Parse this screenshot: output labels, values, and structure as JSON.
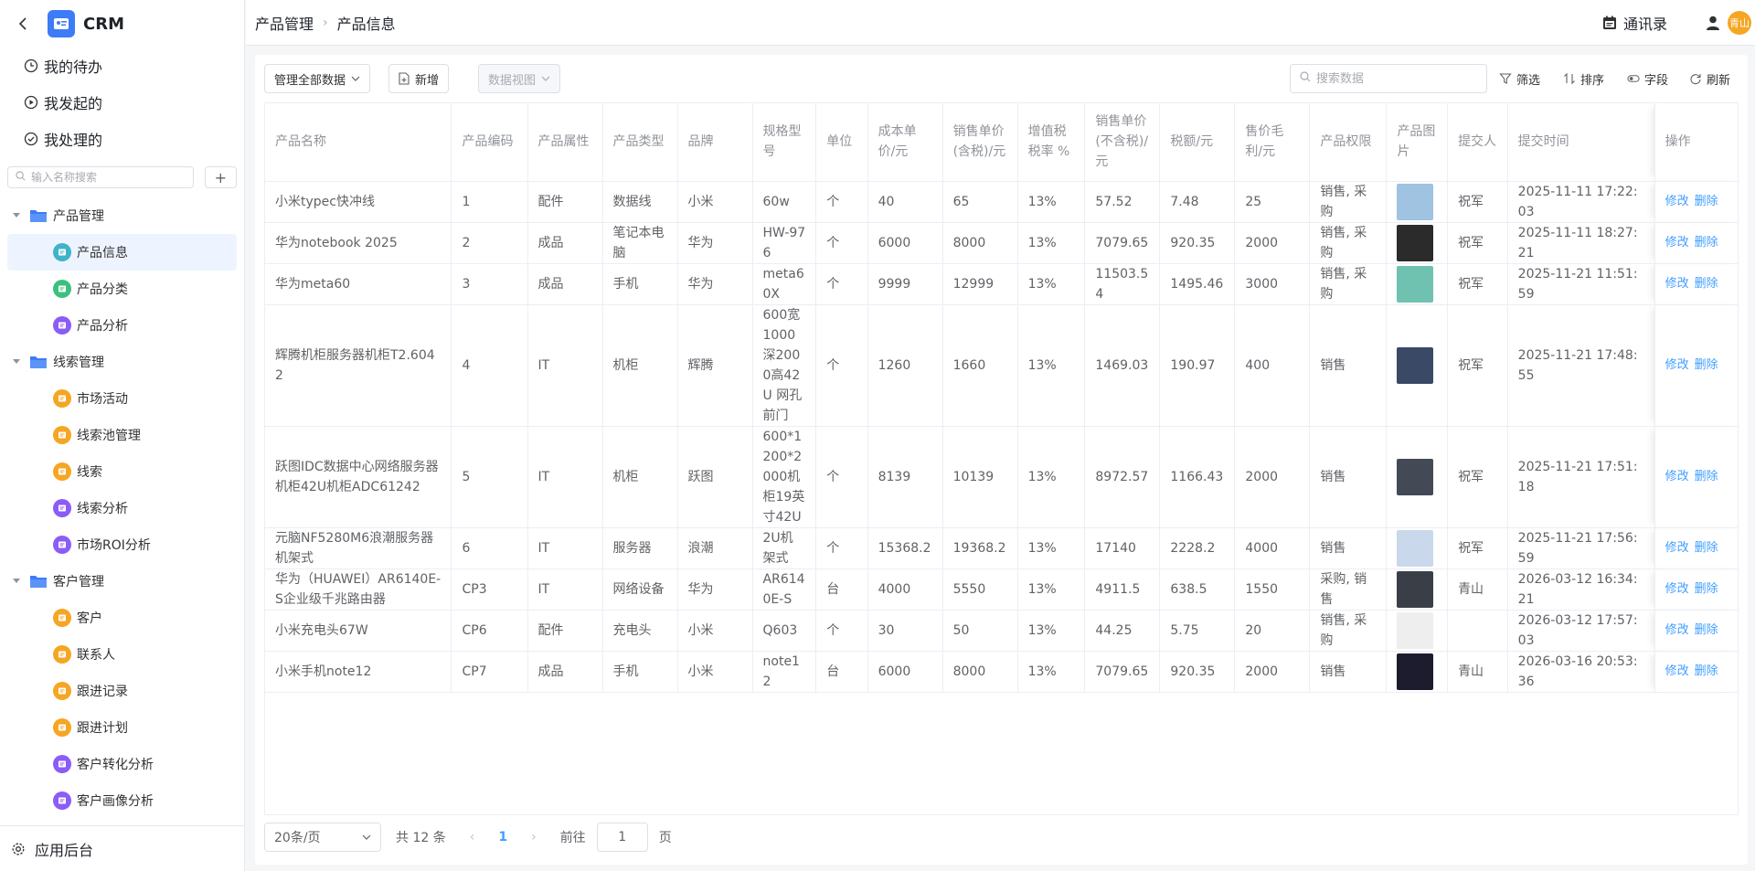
{
  "app": {
    "name": "CRM",
    "back_icon": "chevron-left-icon",
    "logo_icon": "crm-logo-icon",
    "accent": "#3d7bf7"
  },
  "quick": [
    {
      "label": "我的待办",
      "icon": "clock-icon"
    },
    {
      "label": "我发起的",
      "icon": "play-circle-icon"
    },
    {
      "label": "我处理的",
      "icon": "check-circle-icon"
    }
  ],
  "tree_search": {
    "placeholder": "输入名称搜索",
    "add": "+"
  },
  "tree": [
    {
      "label": "产品管理",
      "children": [
        {
          "label": "产品信息",
          "color": "#3fb4c8",
          "active": true
        },
        {
          "label": "产品分类",
          "color": "#3cc07e"
        },
        {
          "label": "产品分析",
          "color": "#8b5cf6"
        }
      ]
    },
    {
      "label": "线索管理",
      "children": [
        {
          "label": "市场活动",
          "color": "#f5a623"
        },
        {
          "label": "线索池管理",
          "color": "#f5a623"
        },
        {
          "label": "线索",
          "color": "#f5a623"
        },
        {
          "label": "线索分析",
          "color": "#8b5cf6"
        },
        {
          "label": "市场ROI分析",
          "color": "#8b5cf6"
        }
      ]
    },
    {
      "label": "客户管理",
      "children": [
        {
          "label": "客户",
          "color": "#f5a623"
        },
        {
          "label": "联系人",
          "color": "#f5a623"
        },
        {
          "label": "跟进记录",
          "color": "#f5a623"
        },
        {
          "label": "跟进计划",
          "color": "#f5a623"
        },
        {
          "label": "客户转化分析",
          "color": "#8b5cf6"
        },
        {
          "label": "客户画像分析",
          "color": "#8b5cf6"
        }
      ]
    }
  ],
  "side_bottom": {
    "label": "应用后台",
    "icon": "gear-icon"
  },
  "header": {
    "crumbs": [
      "产品管理",
      "产品信息"
    ],
    "contacts": "通讯录",
    "avatar": "青山"
  },
  "toolbar": {
    "scope": "管理全部数据",
    "add": "新增",
    "view": "数据视图",
    "search_placeholder": "搜索数据",
    "filter": "筛选",
    "sort": "排序",
    "fields": "字段",
    "refresh": "刷新"
  },
  "columns": [
    "产品名称",
    "产品编码",
    "产品属性",
    "产品类型",
    "品牌",
    "规格型号",
    "单位",
    "成本单价/元",
    "销售单价(含税)/元",
    "增值税税率 %",
    "销售单价(不含税)/元",
    "税额/元",
    "售价毛利/元",
    "产品权限",
    "产品图片",
    "提交人",
    "提交时间",
    "操作"
  ],
  "rows": [
    {
      "name": "小米typec快冲线",
      "code": "1",
      "attr": "配件",
      "type": "数据线",
      "brand": "小米",
      "spec": "60w",
      "unit": "个",
      "cost": "40",
      "price_tax": "65",
      "rate": "13%",
      "price_notax": "57.52",
      "tax": "7.48",
      "margin": "25",
      "perm": "销售, 采购",
      "img_color": "#9fc3e0",
      "submitter": "祝军",
      "time": "2025-11-11 17:22:03"
    },
    {
      "name": "华为notebook 2025",
      "code": "2",
      "attr": "成品",
      "type": "笔记本电脑",
      "brand": "华为",
      "spec": "HW-976",
      "unit": "个",
      "cost": "6000",
      "price_tax": "8000",
      "rate": "13%",
      "price_notax": "7079.65",
      "tax": "920.35",
      "margin": "2000",
      "perm": "销售, 采购",
      "img_color": "#2b2b2b",
      "submitter": "祝军",
      "time": "2025-11-11 18:27:21"
    },
    {
      "name": "华为meta60",
      "code": "3",
      "attr": "成品",
      "type": "手机",
      "brand": "华为",
      "spec": "meta60X",
      "unit": "个",
      "cost": "9999",
      "price_tax": "12999",
      "rate": "13%",
      "price_notax": "11503.54",
      "tax": "1495.46",
      "margin": "3000",
      "perm": "销售, 采购",
      "img_color": "#6fc2b0",
      "submitter": "祝军",
      "time": "2025-11-21 11:51:59"
    },
    {
      "name": "辉腾机柜服务器机柜T2.6042",
      "code": "4",
      "attr": "IT",
      "type": "机柜",
      "brand": "辉腾",
      "spec": "600宽1000深2000高42U 网孔前门",
      "unit": "个",
      "cost": "1260",
      "price_tax": "1660",
      "rate": "13%",
      "price_notax": "1469.03",
      "tax": "190.97",
      "margin": "400",
      "perm": "销售",
      "img_color": "#3a4a66",
      "submitter": "祝军",
      "time": "2025-11-21 17:48:55"
    },
    {
      "name": "跃图IDC数据中心网络服务器机柜42U机柜ADC61242",
      "code": "5",
      "attr": "IT",
      "type": "机柜",
      "brand": "跃图",
      "spec": "600*1200*2000机柜19英寸42U",
      "unit": "个",
      "cost": "8139",
      "price_tax": "10139",
      "rate": "13%",
      "price_notax": "8972.57",
      "tax": "1166.43",
      "margin": "2000",
      "perm": "销售",
      "img_color": "#444a55",
      "submitter": "祝军",
      "time": "2025-11-21 17:51:18"
    },
    {
      "name": "元脑NF5280M6浪潮服务器机架式",
      "code": "6",
      "attr": "IT",
      "type": "服务器",
      "brand": "浪潮",
      "spec": "2U机架式",
      "unit": "个",
      "cost": "15368.2",
      "price_tax": "19368.2",
      "rate": "13%",
      "price_notax": "17140",
      "tax": "2228.2",
      "margin": "4000",
      "perm": "销售",
      "img_color": "#c9d8ea",
      "submitter": "祝军",
      "time": "2025-11-21 17:56:59"
    },
    {
      "name": "华为（HUAWEI）AR6140E-S企业级千兆路由器",
      "code": "CP3",
      "attr": "IT",
      "type": "网络设备",
      "brand": "华为",
      "spec": "AR6140E-S",
      "unit": "台",
      "cost": "4000",
      "price_tax": "5550",
      "rate": "13%",
      "price_notax": "4911.5",
      "tax": "638.5",
      "margin": "1550",
      "perm": "采购, 销售",
      "img_color": "#3a3f47",
      "submitter": "青山",
      "time": "2026-03-12 16:34:21"
    },
    {
      "name": "小米充电头67W",
      "code": "CP6",
      "attr": "配件",
      "type": "充电头",
      "brand": "小米",
      "spec": "Q603",
      "unit": "个",
      "cost": "30",
      "price_tax": "50",
      "rate": "13%",
      "price_notax": "44.25",
      "tax": "5.75",
      "margin": "20",
      "perm": "销售, 采购",
      "img_color": "#eeeeee",
      "submitter": "",
      "time": "2026-03-12 17:57:03"
    },
    {
      "name": "小米手机note12",
      "code": "CP7",
      "attr": "成品",
      "type": "手机",
      "brand": "小米",
      "spec": "note12",
      "unit": "台",
      "cost": "6000",
      "price_tax": "8000",
      "rate": "13%",
      "price_notax": "7079.65",
      "tax": "920.35",
      "margin": "2000",
      "perm": "销售",
      "img_color": "#1c1c2e",
      "submitter": "青山",
      "time": "2026-03-16 20:53:36"
    }
  ],
  "ops": {
    "edit": "修改",
    "delete": "删除"
  },
  "pager": {
    "size": "20条/页",
    "total": "共 12 条",
    "page": "1",
    "goto": "前往",
    "goto_value": "1",
    "page_unit": "页"
  }
}
